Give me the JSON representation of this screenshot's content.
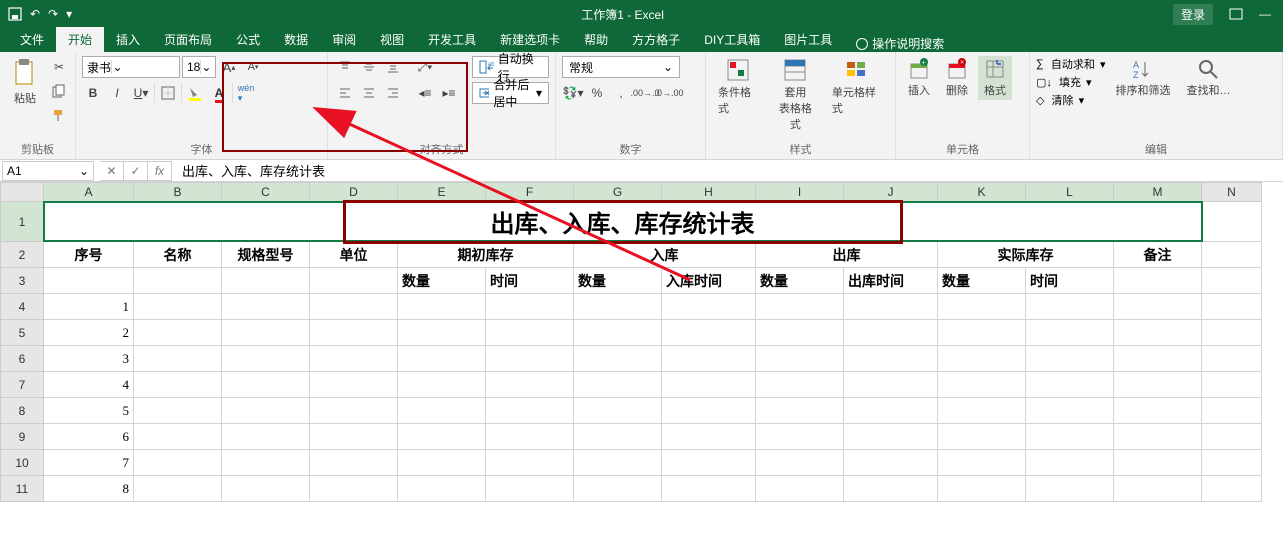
{
  "titlebar": {
    "title": "工作簿1 - Excel",
    "login": "登录"
  },
  "tabs": {
    "file": "文件",
    "home": "开始",
    "insert": "插入",
    "layout": "页面布局",
    "formulas": "公式",
    "data": "数据",
    "review": "审阅",
    "view": "视图",
    "dev": "开发工具",
    "newtab": "新建选项卡",
    "help": "帮助",
    "ffgz": "方方格子",
    "diy": "DIY工具箱",
    "pic": "图片工具",
    "tell": "操作说明搜索"
  },
  "ribbon": {
    "clipboard": {
      "label": "剪贴板",
      "paste": "粘贴"
    },
    "font": {
      "label": "字体",
      "name": "隶书",
      "size": "18"
    },
    "align": {
      "label": "对齐方式",
      "wrap": "自动换行",
      "merge": "合并后居中"
    },
    "number": {
      "label": "数字",
      "format": "常规"
    },
    "styles": {
      "label": "样式",
      "cond": "条件格式",
      "table": "套用\n表格格式",
      "cell": "单元格样式"
    },
    "cells": {
      "label": "单元格",
      "insert": "插入",
      "delete": "删除",
      "format": "格式"
    },
    "editing": {
      "label": "编辑",
      "sum": "自动求和",
      "fill": "填充",
      "clear": "清除",
      "sort": "排序和筛选",
      "find": "查找和…"
    }
  },
  "fbar": {
    "ref": "A1",
    "content": "出库、入库、库存统计表"
  },
  "columns": [
    "A",
    "B",
    "C",
    "D",
    "E",
    "F",
    "G",
    "H",
    "I",
    "J",
    "K",
    "L",
    "M",
    "N"
  ],
  "sheet": {
    "title": "出库、入库、库存统计表",
    "headers_row2": {
      "A": "序号",
      "B": "名称",
      "C": "规格型号",
      "D": "单位",
      "EF": "期初库存",
      "GH": "入库",
      "IJ": "出库",
      "KL": "实际库存",
      "M": "备注"
    },
    "headers_row3": {
      "E": "数量",
      "F": "时间",
      "G": "数量",
      "H": "入库时间",
      "I": "数量",
      "J": "出库时间",
      "K": "数量",
      "L": "时间"
    },
    "seq": [
      "1",
      "2",
      "3",
      "4",
      "5",
      "6",
      "7",
      "8"
    ]
  },
  "rownums": [
    "1",
    "2",
    "3",
    "4",
    "5",
    "6",
    "7",
    "8",
    "9",
    "10",
    "11"
  ]
}
